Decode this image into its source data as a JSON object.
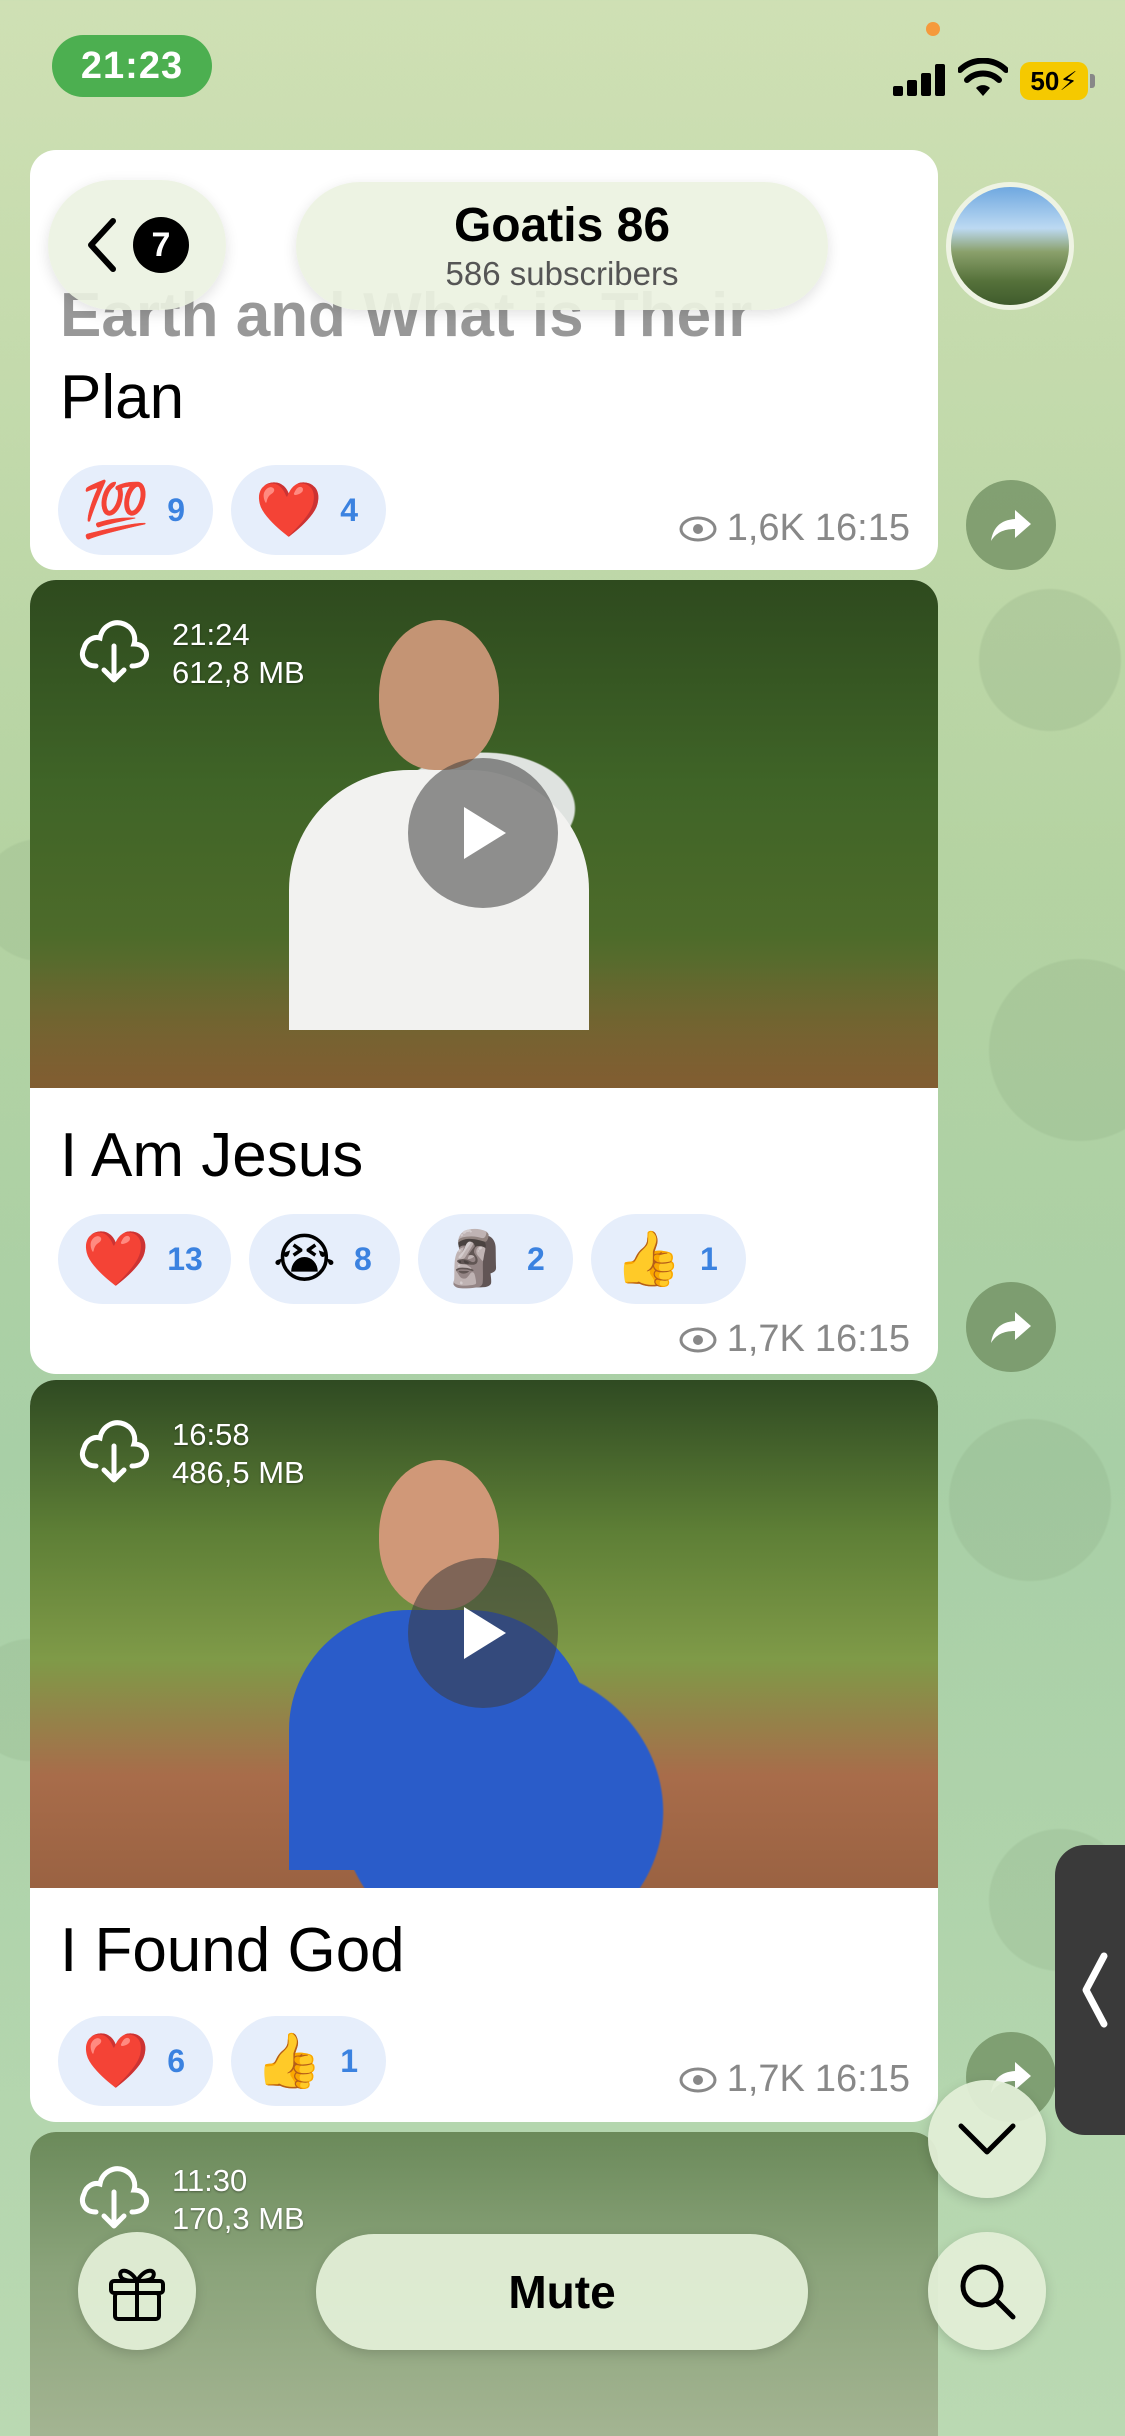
{
  "status_bar": {
    "time": "21:23",
    "battery": "50"
  },
  "header": {
    "back_count": "7",
    "channel_name": "Goatis 86",
    "subscribers": "586 subscribers",
    "avatar_icon": "channel-avatar-mountains"
  },
  "messages": [
    {
      "caption_faded": "Earth and What is Their",
      "caption": "Plan",
      "reactions": [
        {
          "emoji": "💯",
          "count": "9"
        },
        {
          "emoji": "❤️",
          "count": "4"
        }
      ],
      "views": "1,6K",
      "time": "16:15"
    },
    {
      "video_duration": "21:24",
      "video_size": "612,8 MB",
      "caption": "I Am Jesus",
      "reactions": [
        {
          "emoji": "❤️",
          "count": "13"
        },
        {
          "emoji": "😭",
          "count": "8"
        },
        {
          "emoji": "🗿",
          "count": "2"
        },
        {
          "emoji": "👍",
          "count": "1"
        }
      ],
      "views": "1,7K",
      "time": "16:15"
    },
    {
      "video_duration": "16:58",
      "video_size": "486,5 MB",
      "caption": "I Found God",
      "reactions": [
        {
          "emoji": "❤️",
          "count": "6"
        },
        {
          "emoji": "👍",
          "count": "1"
        }
      ],
      "views": "1,7K",
      "time": "16:15"
    },
    {
      "video_duration": "11:30",
      "video_size": "170,3 MB"
    }
  ],
  "bottom_bar": {
    "mute_label": "Mute"
  },
  "colors": {
    "reaction_count": "#3b82e0",
    "reaction_bg": "#e6eefb",
    "time_pill": "#4caf50"
  }
}
